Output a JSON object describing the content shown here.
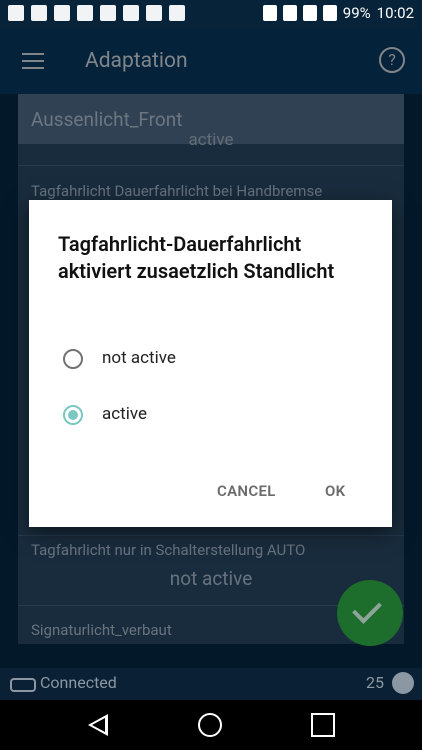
{
  "status_bar": {
    "battery": "99%",
    "time": "10:02"
  },
  "app_bar": {
    "title": "Adaptation",
    "help_glyph": "?"
  },
  "list": {
    "section_header": "Aussenlicht_Front",
    "cut_value": "active",
    "item1_label": "Tagfahrlicht Dauerfahrlicht bei Handbremse",
    "item2_label": "Tagfahrlicht nur in Schalterstellung AUTO",
    "item2_value": "not active",
    "item3_label": "Signaturlicht_verbaut"
  },
  "dialog": {
    "title": "Tagfahrlicht-Dauerfahrlicht aktiviert zusaetzlich Standlicht",
    "options": [
      {
        "label": "not active",
        "selected": false
      },
      {
        "label": "active",
        "selected": true
      }
    ],
    "cancel_label": "CANCEL",
    "ok_label": "OK"
  },
  "bottom_bar": {
    "connection": "Connected",
    "count": "25"
  },
  "colors": {
    "accent_radio": "#7bc7c2",
    "fab": "#1d6d2c",
    "app_bar": "#07355a"
  },
  "icons": [
    "menu-icon",
    "help-icon",
    "check-icon",
    "car-icon",
    "gauge-icon",
    "back-icon",
    "home-icon",
    "recents-icon"
  ]
}
